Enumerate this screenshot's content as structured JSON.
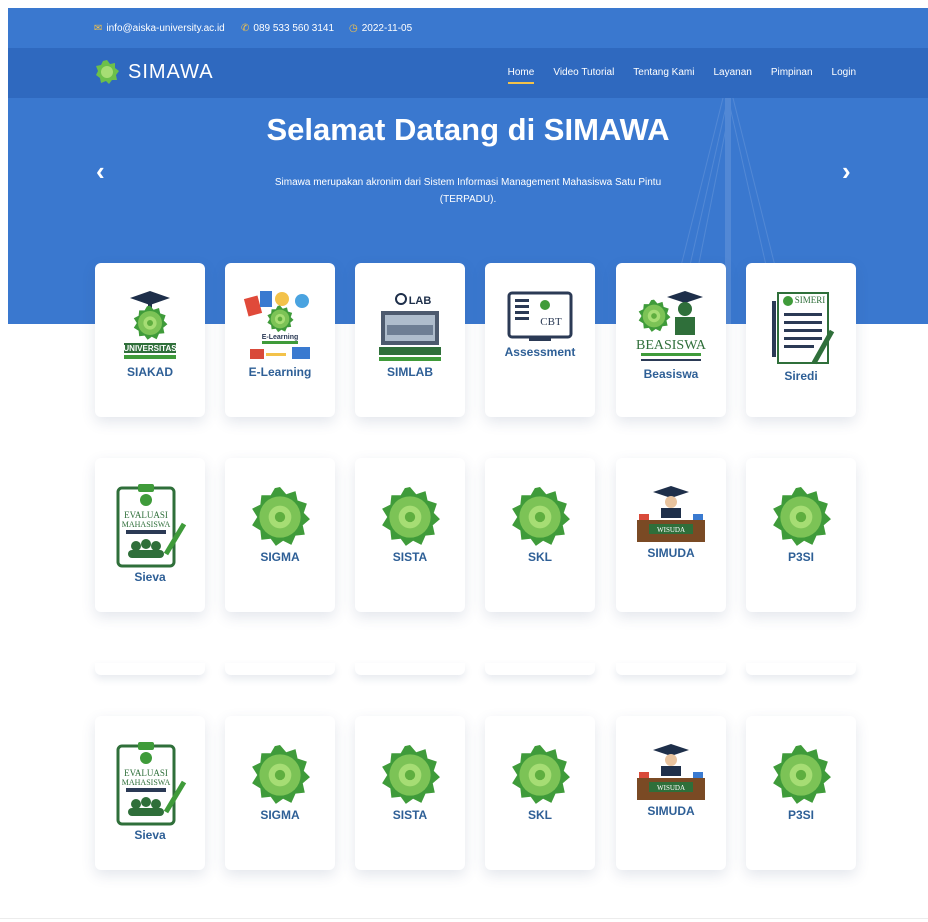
{
  "topbar": {
    "email": "info@aiska-university.ac.id",
    "phone": "089 533 560 3141",
    "date": "2022-11-05"
  },
  "brand": {
    "name": "SIMAWA"
  },
  "nav": {
    "items": [
      "Home",
      "Video Tutorial",
      "Tentang Kami",
      "Layanan",
      "Pimpinan",
      "Login"
    ]
  },
  "hero": {
    "title": "Selamat Datang di SIMAWA",
    "subtitle": "Simawa merupakan akronim dari Sistem Informasi Management Mahasiswa Satu Pintu (TERPADU)."
  },
  "rows": [
    [
      "SIAKAD",
      "E-Learning",
      "SIMLAB",
      "Assessment",
      "Beasiswa",
      "Siredi"
    ],
    [
      "Sieva",
      "SIGMA",
      "SISTA",
      "SKL",
      "SIMUDA",
      "P3SI"
    ],
    [
      "Sieva",
      "SIGMA",
      "SISTA",
      "SKL",
      "SIMUDA",
      "P3SI"
    ]
  ],
  "logo_texts": {
    "siakad_word": "UNIVERSITAS",
    "elearning_word": "E-Learning",
    "simlab_word": "LAB",
    "cbt_word": "CBT",
    "beasiswa_word": "BEASISWA",
    "simeri_word": "SIMERI",
    "evaluasi_word": "EVALUASI",
    "mahasiswa_word": "MAHASISWA",
    "wisuda_word": "WISUDA"
  },
  "colors": {
    "hero_bg": "#3a78cf",
    "nav_bg": "#2f69bf",
    "accent": "#f3c24a",
    "label": "#2e5f96",
    "seal_green": "#3f9b3a"
  }
}
